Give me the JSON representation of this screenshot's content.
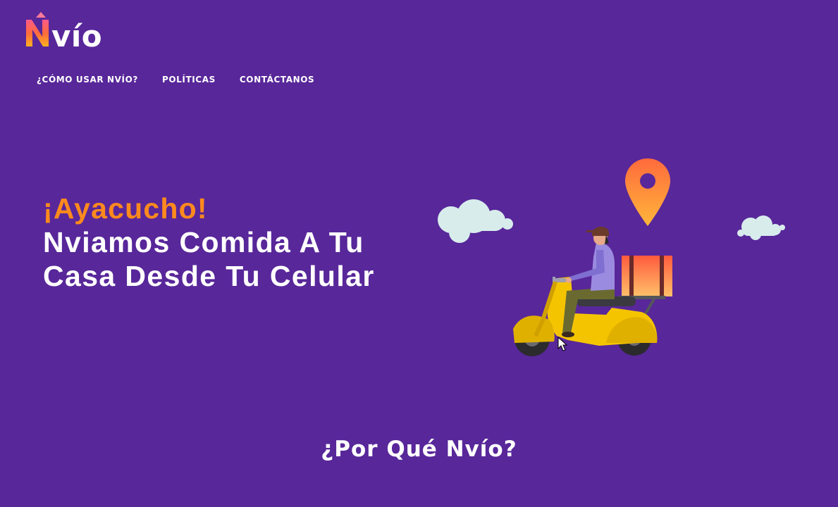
{
  "brand": {
    "logo_text": "Nvío",
    "colors": {
      "background": "#58279a",
      "accent_orange": "#ff8a1d",
      "logo_gradient_start": "#ff6a3d",
      "logo_gradient_end": "#ffb020"
    }
  },
  "nav": {
    "items": [
      {
        "label": "¿CÓMO USAR NVÍO?"
      },
      {
        "label": "POLÍTICAS"
      },
      {
        "label": "CONTÁCTANOS"
      }
    ]
  },
  "hero": {
    "accent": "¡Ayacucho!",
    "title": "Nviamos Comida A Tu Casa Desde Tu Celular",
    "illustration": {
      "icons": [
        "location-pin-icon",
        "cloud-icon",
        "delivery-scooter-icon"
      ]
    }
  },
  "section": {
    "title": "¿Por Qué Nvío?"
  }
}
